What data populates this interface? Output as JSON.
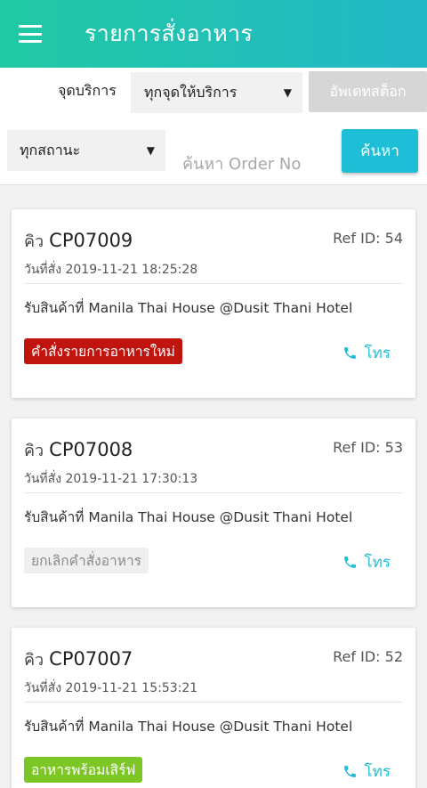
{
  "header": {
    "title": "รายการสั่งอาหาร",
    "menu_icon": "hamburger-menu-icon",
    "gradient_colors": [
      "#21c9a3",
      "#22b8c8"
    ]
  },
  "filters": {
    "service_label": "จุดบริการ",
    "service_select": "ทุกจุดให้บริการ",
    "update_stock_label": "อัพเดทสต็อก",
    "status_select": "ทุกสถานะ",
    "search_placeholder": "ค้นหา Order No",
    "search_button": "ค้นหา"
  },
  "orders": [
    {
      "queue_prefix": "คิว",
      "queue_no": "CP07009",
      "ref": "Ref ID: 54",
      "date": "วันที่สั่ง 2019-11-21 18:25:28",
      "pickup": "รับสินค้าที่ Manila Thai House @Dusit Thani Hotel",
      "status": "คำสั่งรายการอาหารใหม่",
      "status_color": "#c0140f",
      "call_label": "โทร"
    },
    {
      "queue_prefix": "คิว",
      "queue_no": "CP07008",
      "ref": "Ref ID: 53",
      "date": "วันที่สั่ง 2019-11-21 17:30:13",
      "pickup": "รับสินค้าที่ Manila Thai House @Dusit Thani Hotel",
      "status": "ยกเลิกคำสั่งอาหาร",
      "status_color": "#efefef",
      "call_label": "โทร"
    },
    {
      "queue_prefix": "คิว",
      "queue_no": "CP07007",
      "ref": "Ref ID: 52",
      "date": "วันที่สั่ง 2019-11-21 15:53:21",
      "pickup": "รับสินค้าที่ Manila Thai House @Dusit Thani Hotel",
      "status": "อาหารพร้อมเสิร์ฟ",
      "status_color": "#7cc625",
      "call_label": "โทร"
    }
  ]
}
